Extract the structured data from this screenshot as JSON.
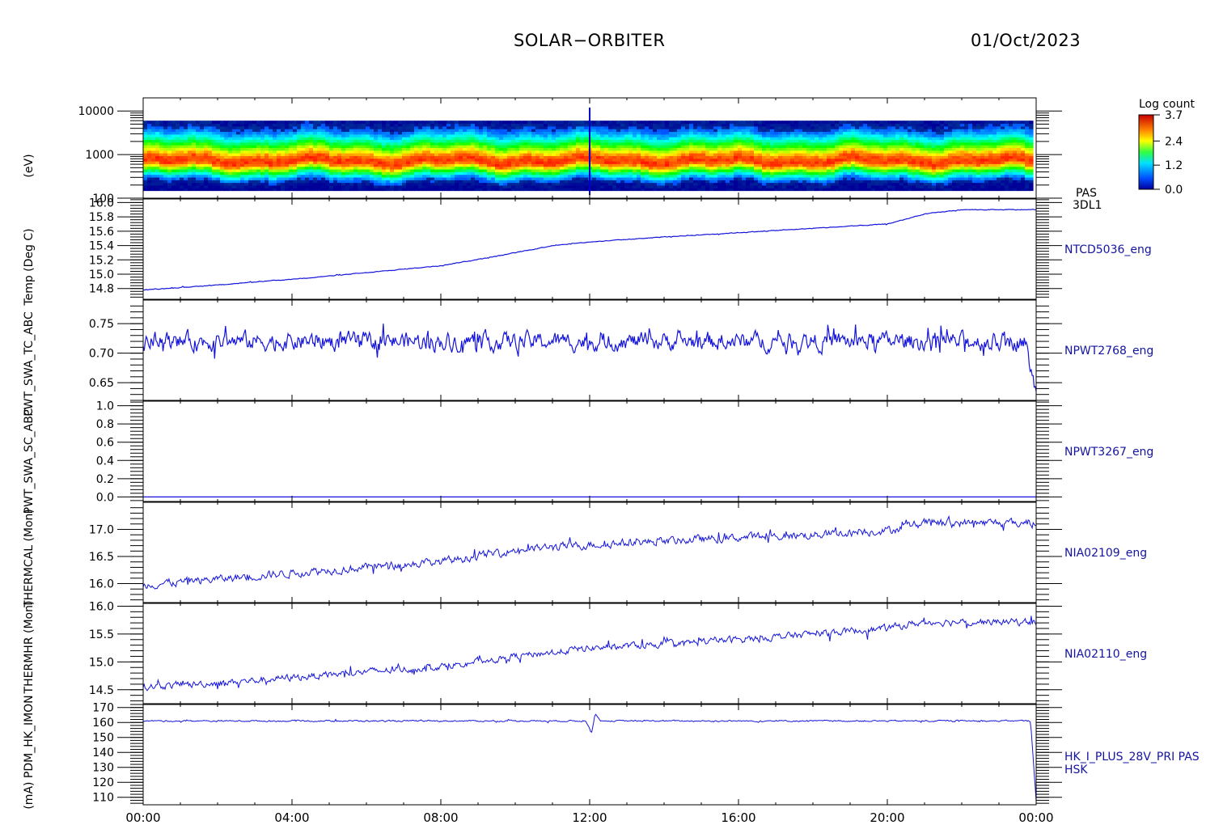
{
  "header": {
    "title": "SOLAR−ORBITER",
    "date": "01/Oct/2023"
  },
  "time_axis": {
    "ticks": [
      "00:00",
      "04:00",
      "08:00",
      "12:00",
      "16:00",
      "20:00",
      "00:00"
    ]
  },
  "colorbar": {
    "title": "Log count",
    "ticks": [
      "3.7",
      "2.4",
      "1.2",
      "0.0"
    ],
    "range": [
      0.0,
      3.7
    ]
  },
  "chart_data": [
    {
      "type": "heatmap",
      "ylabel": "(eV)",
      "right_label": [
        "PAS",
        "3DL1"
      ],
      "yscale": "log",
      "ylim": [
        100,
        20000
      ],
      "yticks": [
        "10000",
        "1000",
        "100"
      ],
      "energy_range": [
        150,
        6000
      ],
      "peak_energy": 700,
      "spike_hour": 12.0
    },
    {
      "type": "line",
      "ylabel": "Temp (Deg C)",
      "series_name": "NTCD5036_eng",
      "ylim": [
        14.65,
        16.05
      ],
      "yticks": [
        "16.0",
        "15.8",
        "15.6",
        "15.4",
        "15.2",
        "15.0",
        "14.8"
      ],
      "x": [
        0,
        2,
        4,
        6,
        8,
        9.5,
        11,
        12,
        14,
        16,
        18,
        20,
        21,
        22,
        23,
        24
      ],
      "values": [
        14.78,
        14.85,
        14.93,
        15.02,
        15.12,
        15.25,
        15.4,
        15.45,
        15.52,
        15.58,
        15.64,
        15.7,
        15.84,
        15.9,
        15.9,
        15.9
      ],
      "noise": 0.004
    },
    {
      "type": "line",
      "ylabel": "PWT_SWA_TC_ABC",
      "series_name": "NPWT2768_eng",
      "ylim": [
        0.62,
        0.79
      ],
      "yticks": [
        "0.75",
        "0.70",
        "0.65"
      ],
      "x": [
        0,
        23.7,
        24
      ],
      "values": [
        0.72,
        0.72,
        0.63
      ],
      "noise": 0.012
    },
    {
      "type": "line",
      "ylabel": "PWT_SWA_SC_ABC",
      "series_name": "NPWT3267_eng",
      "ylim": [
        -0.05,
        1.05
      ],
      "yticks": [
        "1.0",
        "0.8",
        "0.6",
        "0.4",
        "0.2",
        "0.0"
      ],
      "x": [
        0,
        24
      ],
      "values": [
        0.0,
        0.0
      ],
      "noise": 0.0
    },
    {
      "type": "line",
      "ylabel": "THERMCAL (Mon)",
      "series_name": "NIA02109_eng",
      "ylim": [
        15.65,
        17.5
      ],
      "yticks": [
        "17.0",
        "16.5",
        "16.0"
      ],
      "x": [
        0,
        2,
        4,
        6,
        8,
        10,
        12,
        14,
        16,
        18,
        20,
        21,
        24
      ],
      "values": [
        15.98,
        16.08,
        16.2,
        16.3,
        16.4,
        16.62,
        16.72,
        16.78,
        16.85,
        16.9,
        16.98,
        17.12,
        17.12
      ],
      "noise": 0.06
    },
    {
      "type": "line",
      "ylabel": "THERMHR (Mon)",
      "series_name": "NIA02110_eng",
      "ylim": [
        14.25,
        16.05
      ],
      "yticks": [
        "16.0",
        "15.5",
        "15.0",
        "14.5"
      ],
      "x": [
        0,
        2,
        4,
        6,
        8,
        10,
        12,
        14,
        16,
        18,
        20,
        21,
        24
      ],
      "values": [
        14.55,
        14.62,
        14.72,
        14.82,
        14.92,
        15.1,
        15.25,
        15.32,
        15.4,
        15.5,
        15.6,
        15.72,
        15.72
      ],
      "noise": 0.05
    },
    {
      "type": "line",
      "ylabel": "(mA) PDM_HK_IMON",
      "series_name": "HK_I_PLUS_28V_PRI PAS",
      "right_label_extra": "HSK",
      "ylim": [
        105,
        172
      ],
      "yticks": [
        "170",
        "160",
        "150",
        "140",
        "130",
        "120",
        "110"
      ],
      "x": [
        0,
        11.9,
        12.05,
        12.15,
        12.3,
        23.85,
        24
      ],
      "values": [
        161,
        161,
        153,
        166,
        161,
        161,
        108
      ],
      "noise": 0.4
    }
  ]
}
